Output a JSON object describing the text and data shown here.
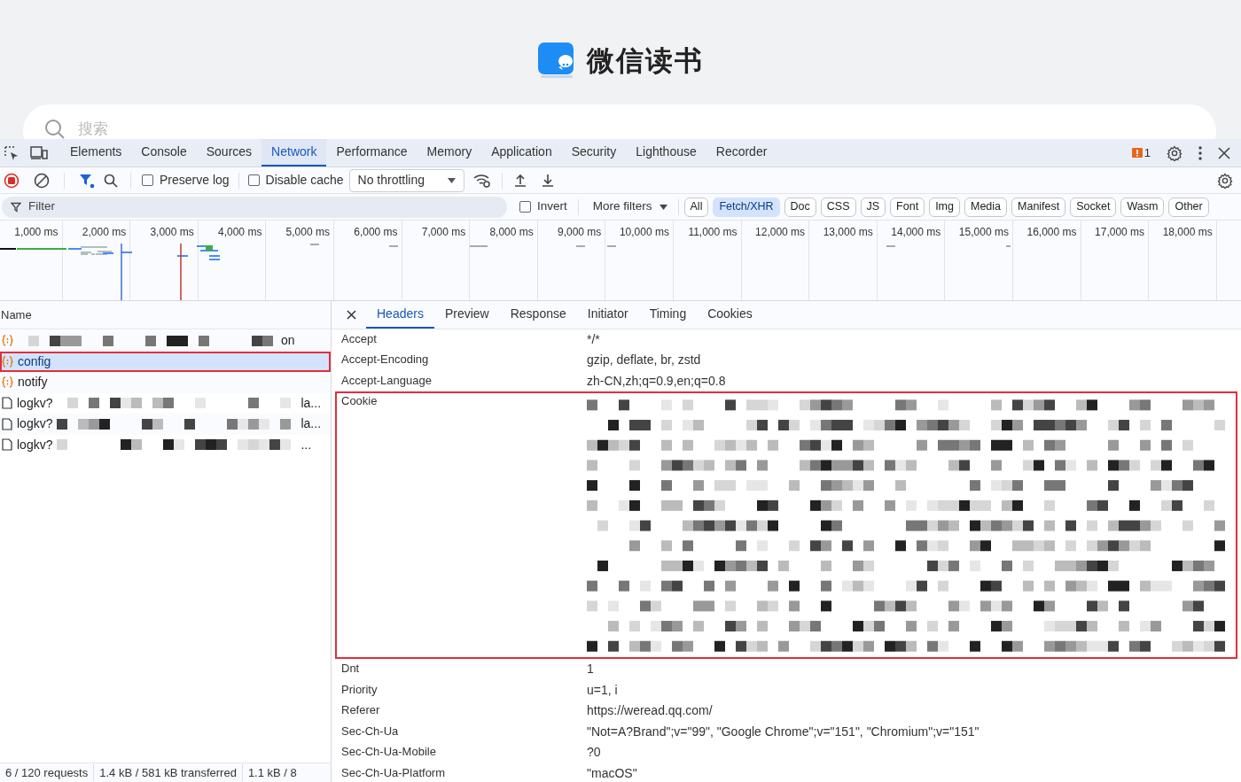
{
  "page": {
    "logo_text": "微信读书",
    "search_placeholder": "搜索"
  },
  "devtools": {
    "tabs": [
      {
        "label": "Elements",
        "selected": false
      },
      {
        "label": "Console",
        "selected": false
      },
      {
        "label": "Sources",
        "selected": false
      },
      {
        "label": "Network",
        "selected": true
      },
      {
        "label": "Performance",
        "selected": false
      },
      {
        "label": "Memory",
        "selected": false
      },
      {
        "label": "Application",
        "selected": false
      },
      {
        "label": "Security",
        "selected": false
      },
      {
        "label": "Lighthouse",
        "selected": false
      },
      {
        "label": "Recorder",
        "selected": false
      }
    ],
    "issues_count": "1"
  },
  "toolbar": {
    "preserve_log": {
      "label": "Preserve log",
      "checked": false
    },
    "disable_cache": {
      "label": "Disable cache",
      "checked": false
    },
    "throttling": "No throttling"
  },
  "filter_bar": {
    "placeholder": "Filter",
    "invert": {
      "label": "Invert",
      "checked": false
    },
    "more_filters": "More filters",
    "types": [
      {
        "label": "All",
        "selected": false
      },
      {
        "label": "Fetch/XHR",
        "selected": true
      },
      {
        "label": "Doc",
        "selected": false
      },
      {
        "label": "CSS",
        "selected": false
      },
      {
        "label": "JS",
        "selected": false
      },
      {
        "label": "Font",
        "selected": false
      },
      {
        "label": "Img",
        "selected": false
      },
      {
        "label": "Media",
        "selected": false
      },
      {
        "label": "Manifest",
        "selected": false
      },
      {
        "label": "Socket",
        "selected": false
      },
      {
        "label": "Wasm",
        "selected": false
      },
      {
        "label": "Other",
        "selected": false
      }
    ]
  },
  "timeline": {
    "ticks": [
      "1,000 ms",
      "2,000 ms",
      "3,000 ms",
      "4,000 ms",
      "5,000 ms",
      "6,000 ms",
      "7,000 ms",
      "8,000 ms",
      "9,000 ms",
      "10,000 ms",
      "11,000 ms",
      "12,000 ms",
      "13,000 ms",
      "14,000 ms",
      "15,000 ms",
      "16,000 ms",
      "17,000 ms",
      "18,000 ms"
    ]
  },
  "requests": {
    "column": "Name",
    "rows": [
      {
        "kind": "fetch",
        "suffix": "on",
        "redacted": true,
        "selected": false,
        "annotated": false
      },
      {
        "kind": "fetch",
        "name": "config",
        "redacted": false,
        "selected": true,
        "annotated": true
      },
      {
        "kind": "fetch",
        "name": "notify",
        "redacted": false,
        "selected": false,
        "annotated": false
      },
      {
        "kind": "document",
        "name": "logkv?",
        "suffix": "la...",
        "redacted": true,
        "selected": false,
        "annotated": false
      },
      {
        "kind": "document",
        "name": "logkv?",
        "suffix": "la...",
        "redacted": true,
        "selected": false,
        "annotated": false
      },
      {
        "kind": "document",
        "name": "logkv?",
        "suffix": "...",
        "redacted": true,
        "selected": false,
        "annotated": false
      }
    ]
  },
  "status_bar": [
    "6 / 120 requests",
    "1.4 kB / 581 kB transferred",
    "1.1 kB / 8"
  ],
  "details": {
    "tabs": [
      {
        "label": "Headers",
        "selected": true
      },
      {
        "label": "Preview",
        "selected": false
      },
      {
        "label": "Response",
        "selected": false
      },
      {
        "label": "Initiator",
        "selected": false
      },
      {
        "label": "Timing",
        "selected": false
      },
      {
        "label": "Cookies",
        "selected": false
      }
    ],
    "headers": [
      {
        "name": "Accept",
        "value": "*/*",
        "redacted": false,
        "annotated": false
      },
      {
        "name": "Accept-Encoding",
        "value": "gzip, deflate, br, zstd",
        "redacted": false,
        "annotated": false
      },
      {
        "name": "Accept-Language",
        "value": "zh-CN,zh;q=0.9,en;q=0.8",
        "redacted": false,
        "annotated": false
      },
      {
        "name": "Cookie",
        "redacted": true,
        "annotated": true
      },
      {
        "name": "Dnt",
        "value": "1",
        "redacted": false,
        "annotated": false
      },
      {
        "name": "Priority",
        "value": "u=1, i",
        "redacted": false,
        "annotated": false
      },
      {
        "name": "Referer",
        "value": "https://weread.qq.com/",
        "redacted": false,
        "annotated": false
      },
      {
        "name": "Sec-Ch-Ua",
        "value": "\"Not=A?Brand\";v=\"99\", \"Google Chrome\";v=\"151\", \"Chromium\";v=\"151\"",
        "redacted": false,
        "annotated": false
      },
      {
        "name": "Sec-Ch-Ua-Mobile",
        "value": "?0",
        "redacted": false,
        "annotated": false
      },
      {
        "name": "Sec-Ch-Ua-Platform",
        "value": "\"macOS\"",
        "redacted": false,
        "annotated": false
      }
    ]
  }
}
